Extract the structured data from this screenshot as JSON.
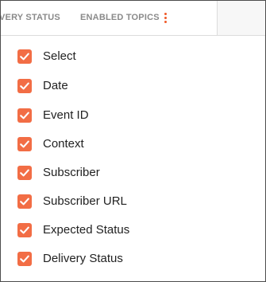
{
  "header": {
    "columns": [
      {
        "label": "VERY STATUS"
      },
      {
        "label": "ENABLED TOPICS"
      }
    ],
    "menu_icon": "kebab-vertical-icon"
  },
  "menu": {
    "items": [
      {
        "label": "Select",
        "checked": true
      },
      {
        "label": "Date",
        "checked": true
      },
      {
        "label": "Event ID",
        "checked": true
      },
      {
        "label": "Context",
        "checked": true
      },
      {
        "label": "Subscriber",
        "checked": true
      },
      {
        "label": "Subscriber URL",
        "checked": true
      },
      {
        "label": "Expected Status",
        "checked": true
      },
      {
        "label": "Delivery Status",
        "checked": true
      }
    ]
  },
  "colors": {
    "accent": "#f26d45",
    "header_text": "#8a8a8a",
    "item_text": "#222222"
  }
}
